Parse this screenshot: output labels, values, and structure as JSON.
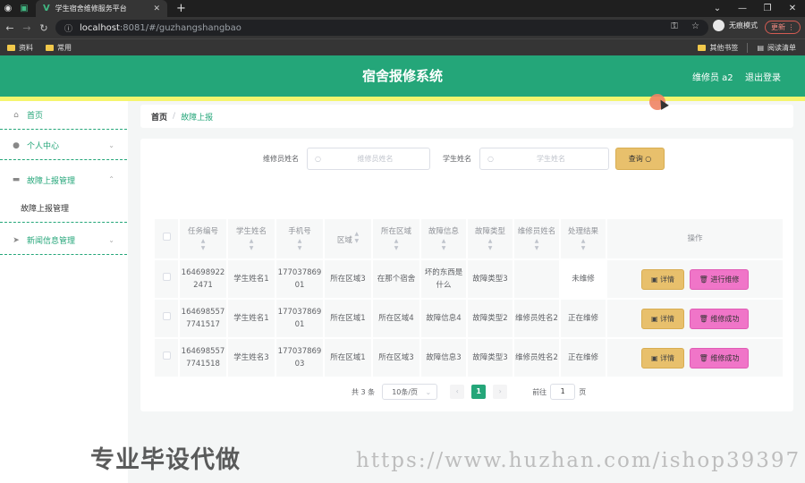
{
  "browser": {
    "tab_title": "学生宿舍维修服务平台",
    "url_host": "localhost",
    "url_rest": ":8081/#/guzhangshangbao",
    "profile_label": "无痕模式",
    "update_label": "更新",
    "bookmarks": [
      "资料",
      "常用"
    ],
    "bookmarks_right": [
      "其他书签",
      "阅读清单"
    ]
  },
  "header": {
    "title": "宿舍报修系统",
    "user": "维修员 a2",
    "logout": "退出登录"
  },
  "sidebar": {
    "items": [
      {
        "label": "首页",
        "icon": "home-icon"
      },
      {
        "label": "个人中心",
        "icon": "user-icon"
      },
      {
        "label": "故障上报管理",
        "icon": "chat-icon"
      },
      {
        "label": "故障上报管理",
        "sub": true
      },
      {
        "label": "新闻信息管理",
        "icon": "send-icon"
      }
    ]
  },
  "breadcrumb": {
    "home": "首页",
    "sep": "/",
    "current": "故障上报"
  },
  "search": {
    "repairer_label": "维修员姓名",
    "repairer_placeholder": "维修员姓名",
    "student_label": "学生姓名",
    "student_placeholder": "学生姓名",
    "query_button": "查询"
  },
  "table": {
    "headers": [
      "任务编号",
      "学生姓名",
      "手机号",
      "区域",
      "所在区域",
      "故障信息",
      "故障类型",
      "维修员姓名",
      "处理结果",
      "操作"
    ],
    "rows": [
      {
        "id": "1646989222471",
        "student": "学生姓名1",
        "phone": "17703786901",
        "area": "所在区域3",
        "location": "在那个宿舍",
        "fault": "坏的东西是什么",
        "type": "故障类型3",
        "repairer": "",
        "result": "未维修",
        "action": "进行维修"
      },
      {
        "id": "1646985577741517",
        "student": "学生姓名1",
        "phone": "17703786901",
        "area": "所在区域1",
        "location": "所在区域4",
        "fault": "故障信息4",
        "type": "故障类型2",
        "repairer": "维修员姓名2",
        "result": "正在维修",
        "action": "维修成功"
      },
      {
        "id": "1646985577741518",
        "student": "学生姓名3",
        "phone": "17703786903",
        "area": "所在区域1",
        "location": "所在区域3",
        "fault": "故障信息3",
        "type": "故障类型3",
        "repairer": "维修员姓名2",
        "result": "正在维修",
        "action": "维修成功"
      }
    ],
    "detail_label": "详情"
  },
  "pagination": {
    "total": "共 3 条",
    "page_size": "10条/页",
    "current_page": "1",
    "goto_label": "前往",
    "goto_value": "1",
    "page_suffix": "页"
  },
  "watermark": {
    "left": "专业毕设代做",
    "right": "https://www.huzhan.com/ishop39397"
  },
  "colors": {
    "brand": "#24a679",
    "accent_yellow": "#e8c06c",
    "accent_pink": "#f075c8"
  }
}
